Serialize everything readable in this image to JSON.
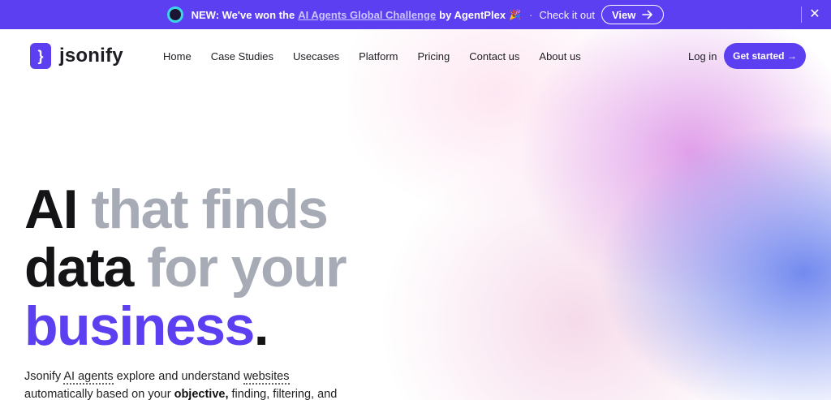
{
  "announcement": {
    "prefix": "NEW: We've won the",
    "link": "AI Agents Global Challenge",
    "suffix": "by AgentPlex",
    "emoji": "🎉",
    "separator": "·",
    "check": "Check it out",
    "view_label": "View",
    "close": "✕"
  },
  "brand": {
    "name": "jsonify",
    "mark": "}"
  },
  "nav": {
    "links": [
      "Home",
      "Case Studies",
      "Usecases",
      "Platform",
      "Pricing",
      "Contact us",
      "About us"
    ],
    "login": "Log in",
    "cta": "Get started →"
  },
  "hero": {
    "line1_a": "AI",
    "line1_b": "that finds",
    "line2_a": "data",
    "line2_b": "for your",
    "line3_a": "business",
    "line3_b": "."
  },
  "subtext": {
    "w1": "Jsonify",
    "w2": "AI agents",
    "w3": "explore and understand",
    "w4": "websites",
    "w5": "automatically based on your",
    "w6": "objective,",
    "w7": "finding, filtering, and"
  },
  "colors": {
    "accent": "#5b3ff0",
    "muted": "#a6abb5",
    "dark": "#141416"
  }
}
